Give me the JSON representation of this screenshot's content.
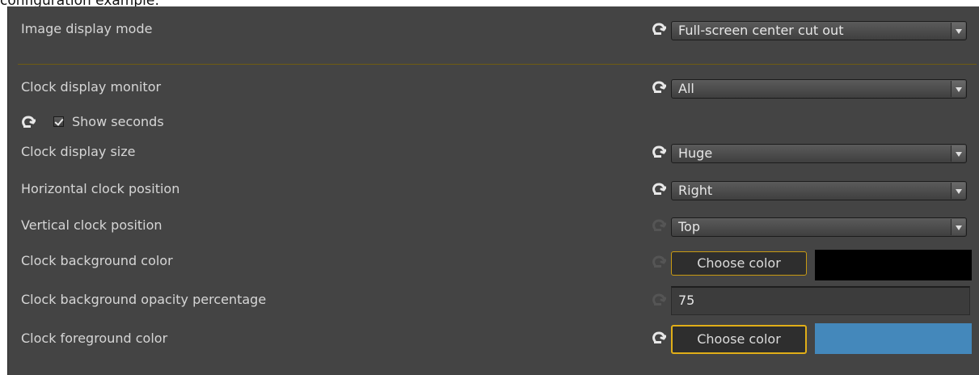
{
  "caption": "configuration example:",
  "colors": {
    "panel_bg": "#444444",
    "divider": "#6f5c12",
    "button_border": "#c89a12",
    "reset_active": "#e8e8e8",
    "reset_inactive": "#555555",
    "clock_background_color": "#000000",
    "clock_foreground_color": "#4488bb"
  },
  "settings": {
    "image_display_mode": {
      "label": "Image display mode",
      "value": "Full-screen center cut out",
      "reset_icon": "reset-arrow-icon"
    },
    "clock_display_monitor": {
      "label": "Clock display monitor",
      "value": "All"
    },
    "show_seconds": {
      "label": "Show seconds",
      "checked": true
    },
    "clock_display_size": {
      "label": "Clock display size",
      "value": "Huge"
    },
    "horizontal_clock_position": {
      "label": "Horizontal clock position",
      "value": "Right"
    },
    "vertical_clock_position": {
      "label": "Vertical clock position",
      "value": "Top"
    },
    "clock_background_color": {
      "label": "Clock background color",
      "button": "Choose color"
    },
    "clock_background_opacity": {
      "label": "Clock background opacity percentage",
      "value": "75"
    },
    "clock_foreground_color": {
      "label": "Clock foreground color",
      "button": "Choose color"
    }
  }
}
